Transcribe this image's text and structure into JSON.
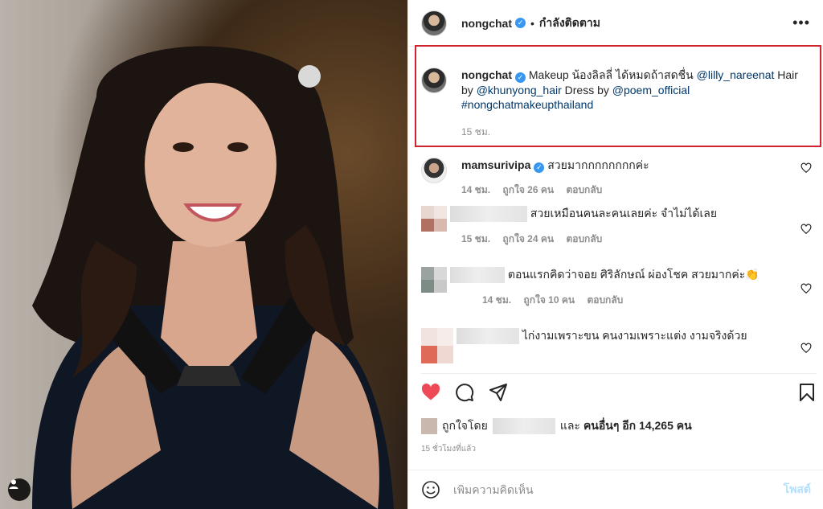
{
  "header": {
    "username": "nongchat",
    "dot": "•",
    "follow_status": "กำลังติดตาม",
    "more_label": "•••"
  },
  "caption": {
    "username": "nongchat",
    "text_1": "Makeup น้องลิลลี่ ได้หมดถ้าสดชื่น",
    "mention_1": "@lilly_nareenat",
    "text_2": "Hair by",
    "mention_2": "@khunyong_hair",
    "text_3": "Dress by",
    "mention_3": "@poem_official",
    "hashtag": "#nongchatmakeupthailand",
    "time": "15 ชม."
  },
  "comments": [
    {
      "username": "mamsurivipa",
      "text": "สวยมากกกกกกกกค่ะ",
      "time": "14 ชม.",
      "likes": "ถูกใจ 26 คน",
      "reply": "ตอบกลับ"
    },
    {
      "text": "สวยเหมือนคนละคนเลยค่ะ จำไม่ได้เลย",
      "time": "15 ชม.",
      "likes": "ถูกใจ 24 คน",
      "reply": "ตอบกลับ"
    },
    {
      "text": "ตอนแรกคิดว่าจอย ศิริลักษณ์ ผ่องโชค สวยมากค่ะ👏",
      "time": "14 ชม.",
      "likes": "ถูกใจ 10 คน",
      "reply": "ตอบกลับ"
    },
    {
      "text": "ไก่งามเพราะขน คนงามเพราะแต่ง งามจริงด้วย"
    }
  ],
  "likes": {
    "liked_by": "ถูกใจโดย",
    "and_others": "และ",
    "others_count": "คนอื่นๆ อีก 14,265 คน"
  },
  "timestamp": "15 ชั่วโมงที่แล้ว",
  "add_comment": {
    "placeholder": "เพิ่มความคิดเห็น",
    "post_label": "โพสต์"
  },
  "icons": {
    "like": "heart-filled-icon",
    "comment": "comment-icon",
    "share": "share-icon",
    "save": "bookmark-icon",
    "emoji": "emoji-icon",
    "user_tag": "user-icon"
  },
  "colors": {
    "like_red": "#ed4956",
    "highlight_border": "#d0232d",
    "link": "#00376b",
    "verified": "#3897f0",
    "post_disabled": "#b2dffc"
  }
}
